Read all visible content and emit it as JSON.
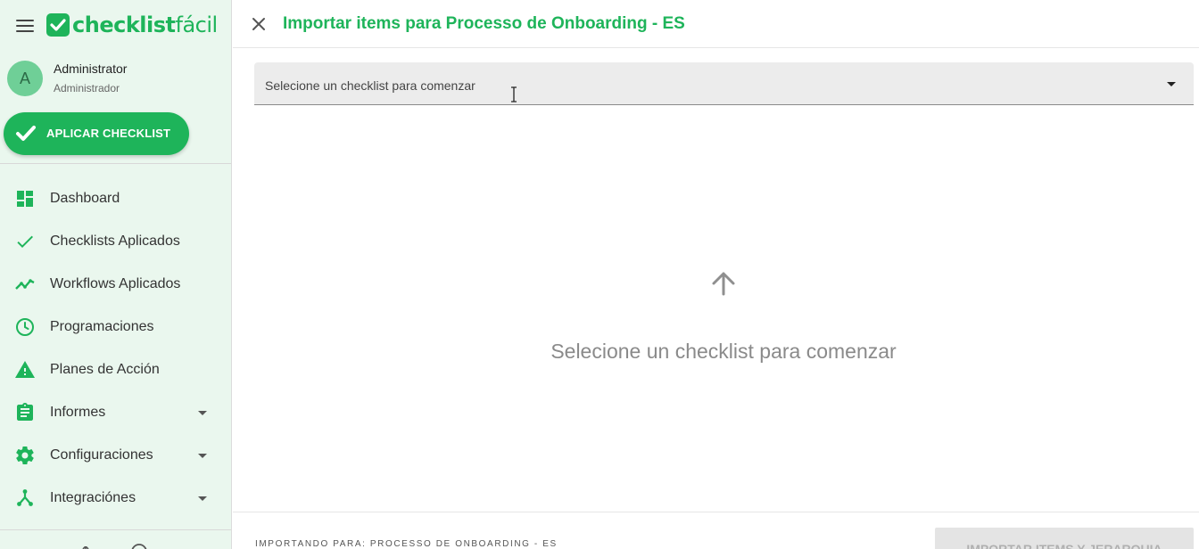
{
  "brand": {
    "logo_text_bold": "checklist",
    "logo_text_light": "fácil",
    "color_primary": "#1eb45a"
  },
  "user": {
    "avatar_letter": "A",
    "name": "Administrator",
    "role": "Administrador"
  },
  "sidebar": {
    "apply_button_label": "APLICAR CHECKLIST",
    "items": [
      {
        "label": "Dashboard",
        "icon": "dashboard-icon",
        "expandable": false
      },
      {
        "label": "Checklists Aplicados",
        "icon": "check-icon",
        "expandable": false
      },
      {
        "label": "Workflows Aplicados",
        "icon": "trending-line-icon",
        "expandable": false
      },
      {
        "label": "Programaciones",
        "icon": "clock-icon",
        "expandable": false
      },
      {
        "label": "Planes de Acción",
        "icon": "warning-icon",
        "expandable": false
      },
      {
        "label": "Informes",
        "icon": "clipboard-icon",
        "expandable": true
      },
      {
        "label": "Configuraciones",
        "icon": "gear-icon",
        "expandable": true
      },
      {
        "label": "Integraciónes",
        "icon": "hub-icon",
        "expandable": true
      }
    ]
  },
  "header": {
    "title": "Importar items para Processo de Onboarding - ES"
  },
  "select": {
    "placeholder": "Selecione un checklist para comenzar"
  },
  "empty_state": {
    "message": "Selecione un checklist para comenzar"
  },
  "footer": {
    "importing_label": "IMPORTANDO PARA: PROCESSO DE ONBOARDING - ES",
    "import_button_label": "IMPORTAR ITEMS Y JERARQUIA"
  }
}
